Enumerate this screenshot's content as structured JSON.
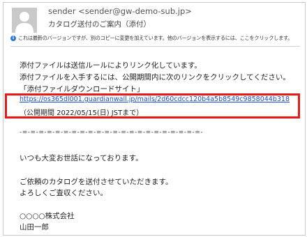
{
  "email": {
    "sender": "sender <sender@gw-demo-sub.jp>",
    "subject": "カタログ送付のご案内（添付）",
    "info_bar": "これは最新のバージョンですが、別のコピーに変更を加えています。他のバージョンを表示するには、ここをクリックします。",
    "body": {
      "line1": "添付ファイルは送信ルールによりリンク化しています。",
      "line2": "添付ファイルを入手するには、公開期間内に次のリンクをクリックしてください。",
      "line3": "「添付ファイルダウンロードサイト」",
      "download_link": "https://os365dl001.guardianwall.jp/mails/2d60cdcc120b4a5b8549c9858044b318",
      "period": "（公開期間 2022/05/15(日) JSTまで）",
      "separator": "-=-=-=-=-=-=-=-=-=-=-=-=-=-=-=-=-=-=-=-=-=-=-",
      "greeting": "いつも大変お世話になっております。",
      "request1": "ご依頼のカタログを送付させていただきます。",
      "request2": "よろしくご査収ください。",
      "company": "○○○○株式会社",
      "signer": "山田一郎"
    }
  },
  "icons": {
    "avatar": "person-avatar-icon",
    "info": "info-icon"
  },
  "colors": {
    "link": "#1a4fc4",
    "highlight": "#e8191a",
    "info_icon": "#2e7bd4"
  }
}
